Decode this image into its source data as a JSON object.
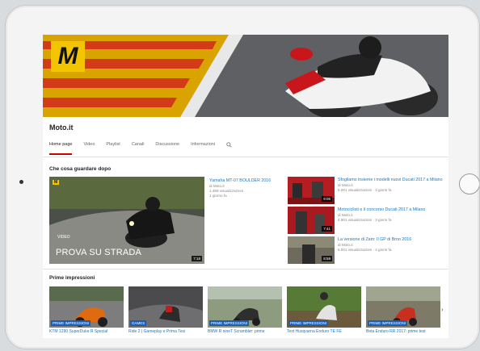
{
  "channel": {
    "logo_text": "M",
    "name": "Moto.it"
  },
  "tabs": [
    {
      "label": "Home page",
      "active": true
    },
    {
      "label": "Video"
    },
    {
      "label": "Playlist"
    },
    {
      "label": "Canali"
    },
    {
      "label": "Discussione"
    },
    {
      "label": "Informazioni"
    }
  ],
  "tab_search_icon": "search-icon",
  "section_next": {
    "title": "Che cosa guardare dopo",
    "featured": {
      "badge": "M",
      "small_text": "VIDEO",
      "caption": "PROVA SU STRADA",
      "duration": "7:18",
      "title": "Yamaha MT-07 BOULDER 2016",
      "channel": "di Moto.it",
      "views": "1.489 visualizzazioni",
      "age": "1 giorno fa"
    },
    "side_videos": [
      {
        "title": "Sfogliamo insieme i modelli nuovi Ducati 2017 a Milano",
        "channel": "di Moto.it",
        "meta": "5.001 visualizzazioni · 3 giorni fa",
        "duration": "9:06"
      },
      {
        "title": "Motociclisti e il concorso Ducati 2017 a Milano",
        "channel": "di Moto.it",
        "meta": "4.801 visualizzazioni · 3 giorni fa",
        "duration": "7:41"
      },
      {
        "title": "La versione di Zam: Il GP di Brno 2016",
        "channel": "di Moto.it",
        "meta": "6.001 visualizzazioni · 4 giorni fa",
        "duration": "8:59"
      }
    ]
  },
  "section_first": {
    "title": "Prime impressioni",
    "items": [
      {
        "label": "PRIME IMPRESSIONI",
        "title": "KTM 1290 SuperDuke R Special"
      },
      {
        "label": "GAMES",
        "title": "Ride 2 | Gameplay e Prima Tesi"
      },
      {
        "label": "PRIME IMPRESSIONI",
        "title": "BMW R nineT Scrambler: prime"
      },
      {
        "label": "PRIME IMPRESSIONI",
        "title": "Test Husqvarna Enduro TE FE"
      },
      {
        "label": "PRIME IMPRESSIONI",
        "title": "Beta Enduro RR 2017: prime test"
      }
    ],
    "next_icon": "chevron-right-icon"
  }
}
